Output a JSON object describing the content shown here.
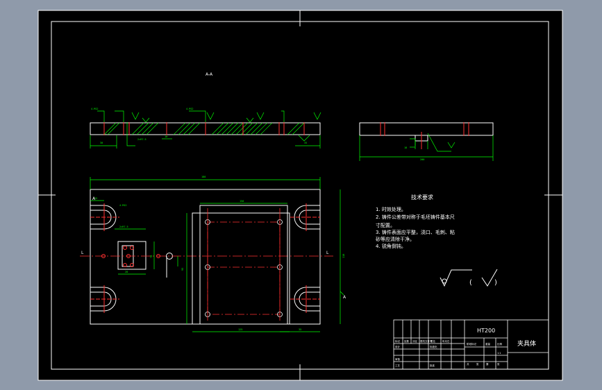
{
  "drawing": {
    "section_label": "A-A",
    "tech_title": "技术要求",
    "tech_items": [
      "1. 时效处理。",
      "2. 铸件公差带对称于毛坯铸件基本尺",
      "寸配置。",
      "3. 铸件表面应平整，浇口、毛刺、粘",
      "砂等应清除干净。",
      "4. 锐角倒钝。"
    ],
    "roughness_symbol": "√",
    "roughness_group": "( √ )",
    "dims": {
      "overall_width": "180",
      "hole_plate_width": "150",
      "d25": "25",
      "d35": "35",
      "d18": "18",
      "d30": "30",
      "d10": "10",
      "d200": "200",
      "d125": "125",
      "d28": "28",
      "label_l": "L",
      "label_a": "A",
      "thread": "4-M12",
      "slot_note": "2×R7.5",
      "vert_95": "95",
      "vert_118": "118",
      "vert_78": "78",
      "vert_200": "200"
    },
    "colors": {
      "frame": "#ffffff",
      "paper": "#000000",
      "outline": "#ffffff",
      "dimension": "#00ff00",
      "centerline": "#ff3030",
      "hatch": "#00ff00"
    }
  },
  "title_block": {
    "material": "HT200",
    "part_name": "夹具体",
    "header_cells": [
      "标记",
      "处数",
      "分区",
      "更改文件号",
      "签名",
      "年月日"
    ],
    "row_labels": [
      "设计",
      "审核",
      "工艺"
    ],
    "mid_cells": [
      "标准化",
      "批准"
    ],
    "stage_cells": [
      "阶段标记",
      "重量",
      "比例"
    ],
    "bottom_cells": [
      "共",
      "张",
      "第",
      "张"
    ],
    "scale": "1:1"
  }
}
